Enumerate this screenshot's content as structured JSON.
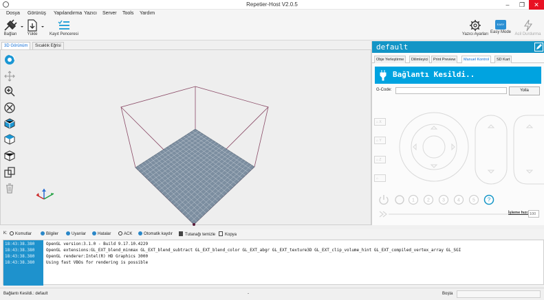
{
  "window": {
    "title": "Repetier-Host V2.0.5"
  },
  "menu": [
    "Dosya",
    "Görünüş",
    "Yapılandırma",
    "Yazıcı",
    "Server",
    "Tools",
    "Yardım"
  ],
  "toolbar": {
    "connect": "Bağlan",
    "load": "Yükle",
    "save_job": "Kayıt Penceresi",
    "printer_settings": "Yazıcı Ayarları",
    "easy_mode": "Easy Mode",
    "easy_badge": "EASY",
    "emergency": "Acil Durdurma"
  },
  "left_tabs": [
    "3D Görünüm",
    "Sıcaklık Eğrisi"
  ],
  "right_panel": {
    "printer_name": "default",
    "tabs": [
      "Obje Yerleştirme",
      "Dilimleyici",
      "Print Preview",
      "Manuel Kontrol",
      "SD Kart"
    ],
    "connection_status": "Bağlantı Kesildi..",
    "gcode_label": "G-Code:",
    "gcode_value": "",
    "send_label": "Yolla",
    "home_buttons": [
      "X",
      "Y",
      "Z",
      ""
    ],
    "extruder_buttons": [
      "1",
      "2",
      "3",
      "4",
      "5",
      "?"
    ],
    "speed_label": "İşleme hızı:",
    "speed_value": "100"
  },
  "log_filters": {
    "prefix": "K:",
    "commands": "Komutlar",
    "info": "Bilgiler",
    "warnings": "Uyarılar",
    "errors": "Hatalar",
    "ack": "ACK",
    "autoscroll": "Otomatik kaydır",
    "clear": "Tutanağı temizle",
    "copy": "Kopya"
  },
  "log": [
    {
      "time": "18:43:38.380",
      "msg": "OpenGL version:3.1.0 - Build 9.17.10.4229"
    },
    {
      "time": "18:43:38.380",
      "msg": "OpenGL extensions:GL_EXT_blend_minmax GL_EXT_blend_subtract GL_EXT_blend_color GL_EXT_abgr GL_EXT_texture3D GL_EXT_clip_volume_hint GL_EXT_compiled_vertex_array GL_SGI"
    },
    {
      "time": "18:43:38.380",
      "msg": "OpenGL renderer:Intel(R) HD Graphics 3000"
    },
    {
      "time": "18:43:38.380",
      "msg": "Using fast VBOs for rendering is possible"
    }
  ],
  "status": {
    "left": "Bağlantı Kesildi.: default",
    "middle": "-",
    "right": "Boşta"
  },
  "colors": {
    "accent": "#1395c6",
    "banner": "#00a3e0",
    "bed": "#7c8ea0",
    "frame": "#8a4a66"
  }
}
